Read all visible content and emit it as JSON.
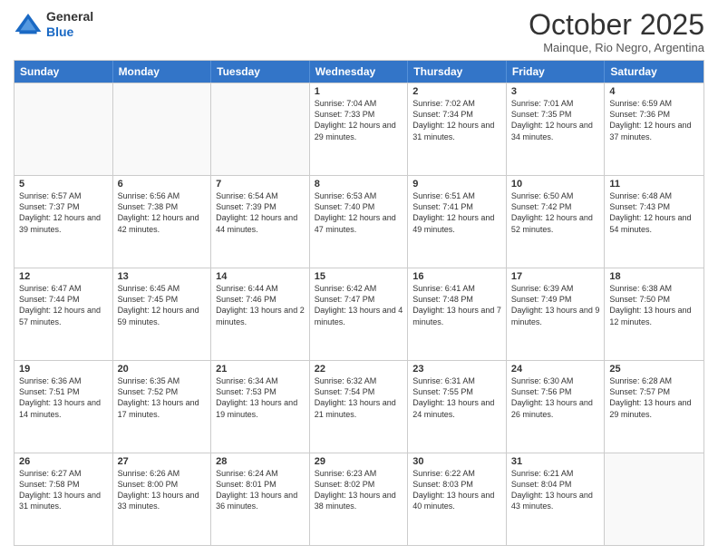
{
  "header": {
    "logo_line1": "General",
    "logo_line2": "Blue",
    "month": "October 2025",
    "location": "Mainque, Rio Negro, Argentina"
  },
  "days_of_week": [
    "Sunday",
    "Monday",
    "Tuesday",
    "Wednesday",
    "Thursday",
    "Friday",
    "Saturday"
  ],
  "weeks": [
    [
      {
        "day": "",
        "empty": true
      },
      {
        "day": "",
        "empty": true
      },
      {
        "day": "",
        "empty": true
      },
      {
        "day": "1",
        "sunrise": "Sunrise: 7:04 AM",
        "sunset": "Sunset: 7:33 PM",
        "daylight": "Daylight: 12 hours and 29 minutes."
      },
      {
        "day": "2",
        "sunrise": "Sunrise: 7:02 AM",
        "sunset": "Sunset: 7:34 PM",
        "daylight": "Daylight: 12 hours and 31 minutes."
      },
      {
        "day": "3",
        "sunrise": "Sunrise: 7:01 AM",
        "sunset": "Sunset: 7:35 PM",
        "daylight": "Daylight: 12 hours and 34 minutes."
      },
      {
        "day": "4",
        "sunrise": "Sunrise: 6:59 AM",
        "sunset": "Sunset: 7:36 PM",
        "daylight": "Daylight: 12 hours and 37 minutes."
      }
    ],
    [
      {
        "day": "5",
        "sunrise": "Sunrise: 6:57 AM",
        "sunset": "Sunset: 7:37 PM",
        "daylight": "Daylight: 12 hours and 39 minutes."
      },
      {
        "day": "6",
        "sunrise": "Sunrise: 6:56 AM",
        "sunset": "Sunset: 7:38 PM",
        "daylight": "Daylight: 12 hours and 42 minutes."
      },
      {
        "day": "7",
        "sunrise": "Sunrise: 6:54 AM",
        "sunset": "Sunset: 7:39 PM",
        "daylight": "Daylight: 12 hours and 44 minutes."
      },
      {
        "day": "8",
        "sunrise": "Sunrise: 6:53 AM",
        "sunset": "Sunset: 7:40 PM",
        "daylight": "Daylight: 12 hours and 47 minutes."
      },
      {
        "day": "9",
        "sunrise": "Sunrise: 6:51 AM",
        "sunset": "Sunset: 7:41 PM",
        "daylight": "Daylight: 12 hours and 49 minutes."
      },
      {
        "day": "10",
        "sunrise": "Sunrise: 6:50 AM",
        "sunset": "Sunset: 7:42 PM",
        "daylight": "Daylight: 12 hours and 52 minutes."
      },
      {
        "day": "11",
        "sunrise": "Sunrise: 6:48 AM",
        "sunset": "Sunset: 7:43 PM",
        "daylight": "Daylight: 12 hours and 54 minutes."
      }
    ],
    [
      {
        "day": "12",
        "sunrise": "Sunrise: 6:47 AM",
        "sunset": "Sunset: 7:44 PM",
        "daylight": "Daylight: 12 hours and 57 minutes."
      },
      {
        "day": "13",
        "sunrise": "Sunrise: 6:45 AM",
        "sunset": "Sunset: 7:45 PM",
        "daylight": "Daylight: 12 hours and 59 minutes."
      },
      {
        "day": "14",
        "sunrise": "Sunrise: 6:44 AM",
        "sunset": "Sunset: 7:46 PM",
        "daylight": "Daylight: 13 hours and 2 minutes."
      },
      {
        "day": "15",
        "sunrise": "Sunrise: 6:42 AM",
        "sunset": "Sunset: 7:47 PM",
        "daylight": "Daylight: 13 hours and 4 minutes."
      },
      {
        "day": "16",
        "sunrise": "Sunrise: 6:41 AM",
        "sunset": "Sunset: 7:48 PM",
        "daylight": "Daylight: 13 hours and 7 minutes."
      },
      {
        "day": "17",
        "sunrise": "Sunrise: 6:39 AM",
        "sunset": "Sunset: 7:49 PM",
        "daylight": "Daylight: 13 hours and 9 minutes."
      },
      {
        "day": "18",
        "sunrise": "Sunrise: 6:38 AM",
        "sunset": "Sunset: 7:50 PM",
        "daylight": "Daylight: 13 hours and 12 minutes."
      }
    ],
    [
      {
        "day": "19",
        "sunrise": "Sunrise: 6:36 AM",
        "sunset": "Sunset: 7:51 PM",
        "daylight": "Daylight: 13 hours and 14 minutes."
      },
      {
        "day": "20",
        "sunrise": "Sunrise: 6:35 AM",
        "sunset": "Sunset: 7:52 PM",
        "daylight": "Daylight: 13 hours and 17 minutes."
      },
      {
        "day": "21",
        "sunrise": "Sunrise: 6:34 AM",
        "sunset": "Sunset: 7:53 PM",
        "daylight": "Daylight: 13 hours and 19 minutes."
      },
      {
        "day": "22",
        "sunrise": "Sunrise: 6:32 AM",
        "sunset": "Sunset: 7:54 PM",
        "daylight": "Daylight: 13 hours and 21 minutes."
      },
      {
        "day": "23",
        "sunrise": "Sunrise: 6:31 AM",
        "sunset": "Sunset: 7:55 PM",
        "daylight": "Daylight: 13 hours and 24 minutes."
      },
      {
        "day": "24",
        "sunrise": "Sunrise: 6:30 AM",
        "sunset": "Sunset: 7:56 PM",
        "daylight": "Daylight: 13 hours and 26 minutes."
      },
      {
        "day": "25",
        "sunrise": "Sunrise: 6:28 AM",
        "sunset": "Sunset: 7:57 PM",
        "daylight": "Daylight: 13 hours and 29 minutes."
      }
    ],
    [
      {
        "day": "26",
        "sunrise": "Sunrise: 6:27 AM",
        "sunset": "Sunset: 7:58 PM",
        "daylight": "Daylight: 13 hours and 31 minutes."
      },
      {
        "day": "27",
        "sunrise": "Sunrise: 6:26 AM",
        "sunset": "Sunset: 8:00 PM",
        "daylight": "Daylight: 13 hours and 33 minutes."
      },
      {
        "day": "28",
        "sunrise": "Sunrise: 6:24 AM",
        "sunset": "Sunset: 8:01 PM",
        "daylight": "Daylight: 13 hours and 36 minutes."
      },
      {
        "day": "29",
        "sunrise": "Sunrise: 6:23 AM",
        "sunset": "Sunset: 8:02 PM",
        "daylight": "Daylight: 13 hours and 38 minutes."
      },
      {
        "day": "30",
        "sunrise": "Sunrise: 6:22 AM",
        "sunset": "Sunset: 8:03 PM",
        "daylight": "Daylight: 13 hours and 40 minutes."
      },
      {
        "day": "31",
        "sunrise": "Sunrise: 6:21 AM",
        "sunset": "Sunset: 8:04 PM",
        "daylight": "Daylight: 13 hours and 43 minutes."
      },
      {
        "day": "",
        "empty": true
      }
    ]
  ]
}
